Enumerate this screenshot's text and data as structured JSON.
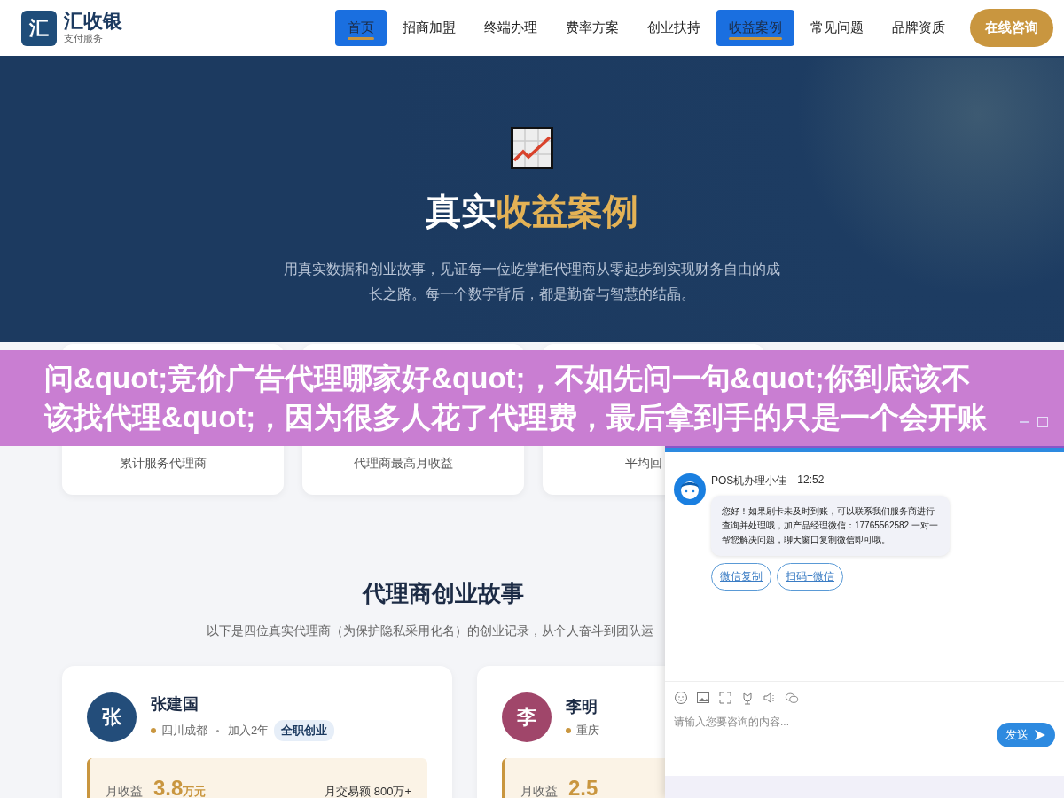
{
  "header": {
    "logo_mark": "汇",
    "logo_name": "汇收银",
    "logo_sub": "支付服务",
    "nav": [
      {
        "label": "首页",
        "selected": true
      },
      {
        "label": "招商加盟",
        "selected": false
      },
      {
        "label": "终端办理",
        "selected": false
      },
      {
        "label": "费率方案",
        "selected": false
      },
      {
        "label": "创业扶持",
        "selected": false
      },
      {
        "label": "收益案例",
        "selected": true
      },
      {
        "label": "常见问题",
        "selected": false
      },
      {
        "label": "品牌资质",
        "selected": false
      }
    ],
    "cta": "在线咨询"
  },
  "hero": {
    "title_plain": "真实",
    "title_accent": "收益案例",
    "subtitle": "用真实数据和创业故事，见证每一位屹掌柜代理商从零起步到实现财务自由的成长之路。每一个数字背后，都是勤奋与智慧的结晶。"
  },
  "stats": [
    {
      "label": "累计服务代理商"
    },
    {
      "label": "代理商最高月收益"
    },
    {
      "label": "平均回"
    }
  ],
  "stories": {
    "title": "代理商创业故事",
    "subtitle": "以下是四位真实代理商（为保护隐私采用化名）的创业记录，从个人奋斗到团队运",
    "cards": [
      {
        "avatar": "张",
        "color": "#234d7a",
        "name": "张建国",
        "city": "四川成都",
        "joined": "加入2年",
        "tag": "全职创业",
        "income_label": "月收益",
        "income": "3.8",
        "income_unit": "万元",
        "volume": "月交易额 800万+"
      },
      {
        "avatar": "李",
        "color": "#a0466a",
        "name": "李明",
        "city": "重庆",
        "income_label": "月收益",
        "income": "2.5"
      }
    ]
  },
  "banner": {
    "text": "问&quot;竞价广告代理哪家好&quot;，不如先问一句&quot;你到底该不该找代理&quot;，因为很多人花了代理费，最后拿到手的只是一个会开账"
  },
  "chat": {
    "agent": "POS机办理小佳",
    "time": "12:52",
    "message": "您好！如果刷卡未及时到账，可以联系我们服务商进行查询并处理哦，加产品经理微信：17765562582 一对一帮您解决问题，聊天窗口复制微信即可哦。",
    "actions": [
      "微信复制",
      "扫码+微信"
    ],
    "placeholder": "请输入您要咨询的内容...",
    "send": "发送"
  }
}
